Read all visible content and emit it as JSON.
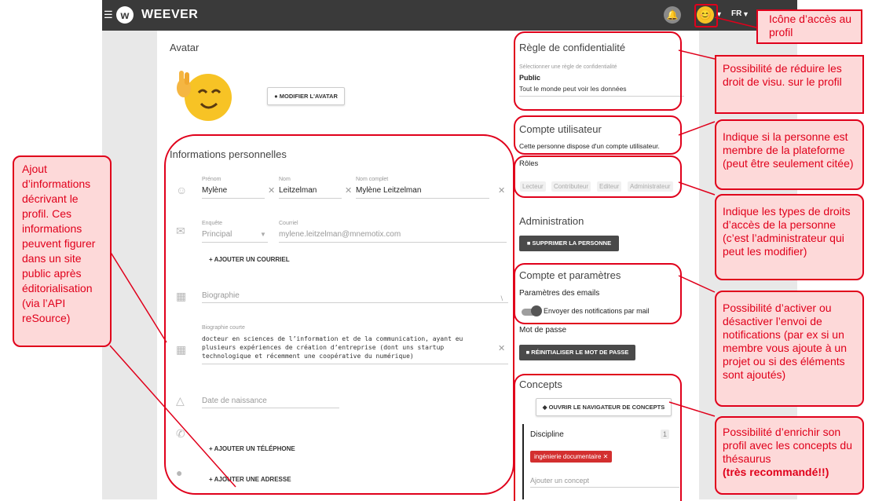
{
  "header": {
    "menu_icon": "hamburger-icon",
    "logo_text": "WEEVER",
    "bell_icon": "bell-icon",
    "lang": "FR"
  },
  "avatar_section": {
    "title": "Avatar",
    "modify_button": "MODIFIER L'AVATAR"
  },
  "personal_info": {
    "title": "Informations personnelles",
    "prenom_label": "Prénom",
    "prenom_value": "Mylène",
    "nom_label": "Nom",
    "nom_value": "Leitzelman",
    "nom_complet_label": "Nom complet",
    "nom_complet_value": "Mylène Leitzelman",
    "enquete_label": "Enquête",
    "enquete_value": "Principal",
    "courriel_label": "Courriel",
    "courriel_value": "mylene.leitzelman@mnemotix.com",
    "add_email": "AJOUTER UN COURRIEL",
    "biographie_placeholder": "Biographie",
    "bio_courte_label": "Biographie courte",
    "bio_courte_value": "docteur en sciences de l’information et de la communication, ayant eu plusieurs expériences de création d’entreprise (dont uns startup technologique et récemment une coopérative du numérique)",
    "birth_placeholder": "Date de naissance",
    "add_phone": "AJOUTER UN TÉLÉPHONE",
    "add_address": "AJOUTER UNE ADRESSE"
  },
  "privacy": {
    "title": "Règle de confidentialité",
    "select_label": "Sélectionner une règle de confidentialité",
    "value": "Public",
    "description": "Tout le monde peut voir les données"
  },
  "user_account": {
    "title": "Compte utilisateur",
    "text": "Cette personne dispose d'un compte utilisateur."
  },
  "roles": {
    "title": "Rôles",
    "items": [
      "Lecteur",
      "Contributeur",
      "Editeur",
      "Administrateur"
    ]
  },
  "administration": {
    "title": "Administration",
    "delete_button": "SUPPRIMER LA PERSONNE"
  },
  "account_settings": {
    "title": "Compte et paramètres",
    "email_params_title": "Paramètres des emails",
    "toggle_label": "Envoyer des notifications par mail",
    "password_title": "Mot de passe",
    "reset_button": "RÉINITIALISER LE MOT DE PASSE"
  },
  "concepts": {
    "title": "Concepts",
    "open_browser_button": "OUVRIR LE NAVIGATEUR DE CONCEPTS",
    "discipline_label": "Discipline",
    "discipline_count": "1",
    "tag": "ingénierie documentaire",
    "add_placeholder": "Ajouter un concept"
  },
  "annotations": {
    "profile_access": "Icône d’accès au profil",
    "privacy_reduce": "Possibilité de réduire les droit de visu. sur le profil",
    "member_indicator": "Indique si la personne est membre de la plateforme (peut être seulement citée)",
    "roles_indicator": "Indique les types de droits d’accès de la personne (c’est l’administrateur qui peut les modifier)",
    "notifications": "Possibilité d’activer ou désactiver l’envoi de notifications (par ex si un membre vous ajoute à un projet ou si des éléments sont ajoutés)",
    "concepts_enrich": "Possibilité d’enrichir son profil avec les concepts du thésaurus",
    "concepts_recommended": "(très recommandé!!)",
    "left_info": "Ajout d’informations décrivant le profil. Ces informations peuvent figurer dans un site public après éditorialisation (via l’API reSource)"
  },
  "colors": {
    "topbar": "#3a3a3a",
    "annotation_red": "#e0001b",
    "annotation_fill": "#fdd9d9",
    "tag_red": "#d32f2f"
  }
}
